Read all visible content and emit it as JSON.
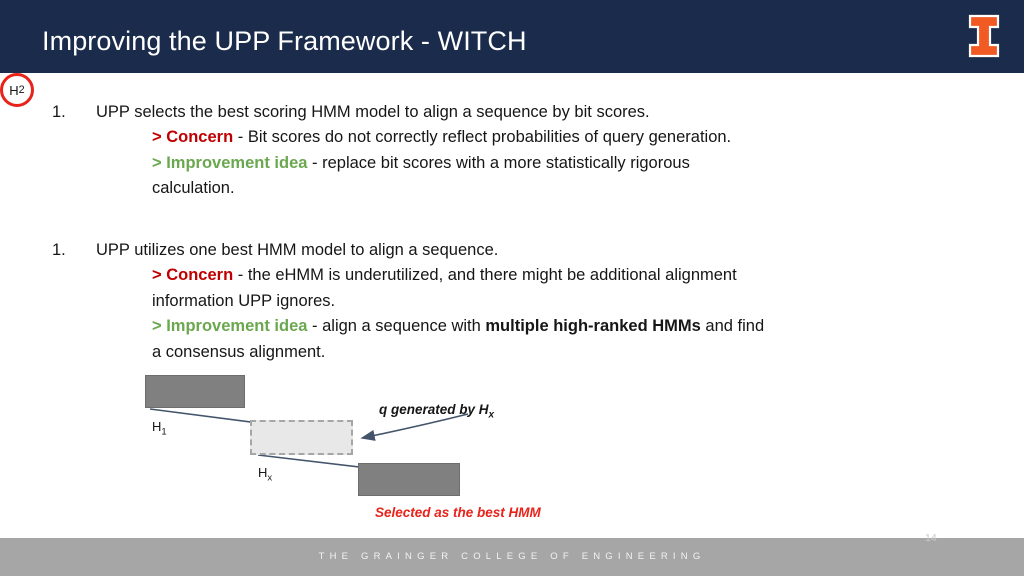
{
  "header": {
    "title": "Improving the UPP Framework - WITCH",
    "logo_name": "illinois-block-i-logo",
    "bar_color": "#1b2b4b",
    "logo_color": "#f15a22"
  },
  "content": {
    "bullets": [
      {
        "number": "1.",
        "text": "UPP selects the best scoring HMM model to align a sequence by bit scores.",
        "lines": [
          {
            "marker": "> Concern",
            "marker_style": "concern",
            "rest": " - Bit scores do not correctly reflect probabilities of query generation."
          },
          {
            "marker": "> Improvement idea",
            "marker_style": "improvement",
            "rest": " - replace bit scores with a more statistically rigorous"
          },
          {
            "marker": "",
            "marker_style": "none",
            "rest": "calculation."
          }
        ]
      },
      {
        "number": "1.",
        "text": "UPP utilizes one best HMM model to align a sequence.",
        "lines": [
          {
            "marker": "> Concern",
            "marker_style": "concern",
            "rest": " - the eHMM is underutilized, and there might be additional alignment"
          },
          {
            "marker": "",
            "marker_style": "none",
            "rest": "information UPP ignores."
          },
          {
            "marker": "> Improvement idea",
            "marker_style": "improvement",
            "rest_pre": " - align a sequence with ",
            "bold": "multiple high-ranked HMMs",
            "rest_post": " and find"
          },
          {
            "marker": "",
            "marker_style": "none",
            "rest": "a consensus alignment."
          }
        ]
      }
    ],
    "colors": {
      "concern": "#c00000",
      "improvement": "#6aa84f",
      "body_text": "#161616"
    }
  },
  "diagram": {
    "box_h1_label": "H",
    "box_h1_sub": "1",
    "box_hx_label": "H",
    "box_hx_sub": "x",
    "box_h2_label": "H",
    "box_h2_sub": "2",
    "annotation_query": "q generated by H",
    "annotation_query_sub": "x",
    "annotation_selected": "Selected as the best HMM",
    "box_fill": "#808080",
    "hx_fill": "#e8e8e8",
    "highlight_color": "#e8231a",
    "arrow_color": "#44546a"
  },
  "footer": {
    "text": "THE GRAINGER COLLEGE OF ENGINEERING",
    "page_number": "14",
    "bar_color": "#a6a6a6"
  }
}
